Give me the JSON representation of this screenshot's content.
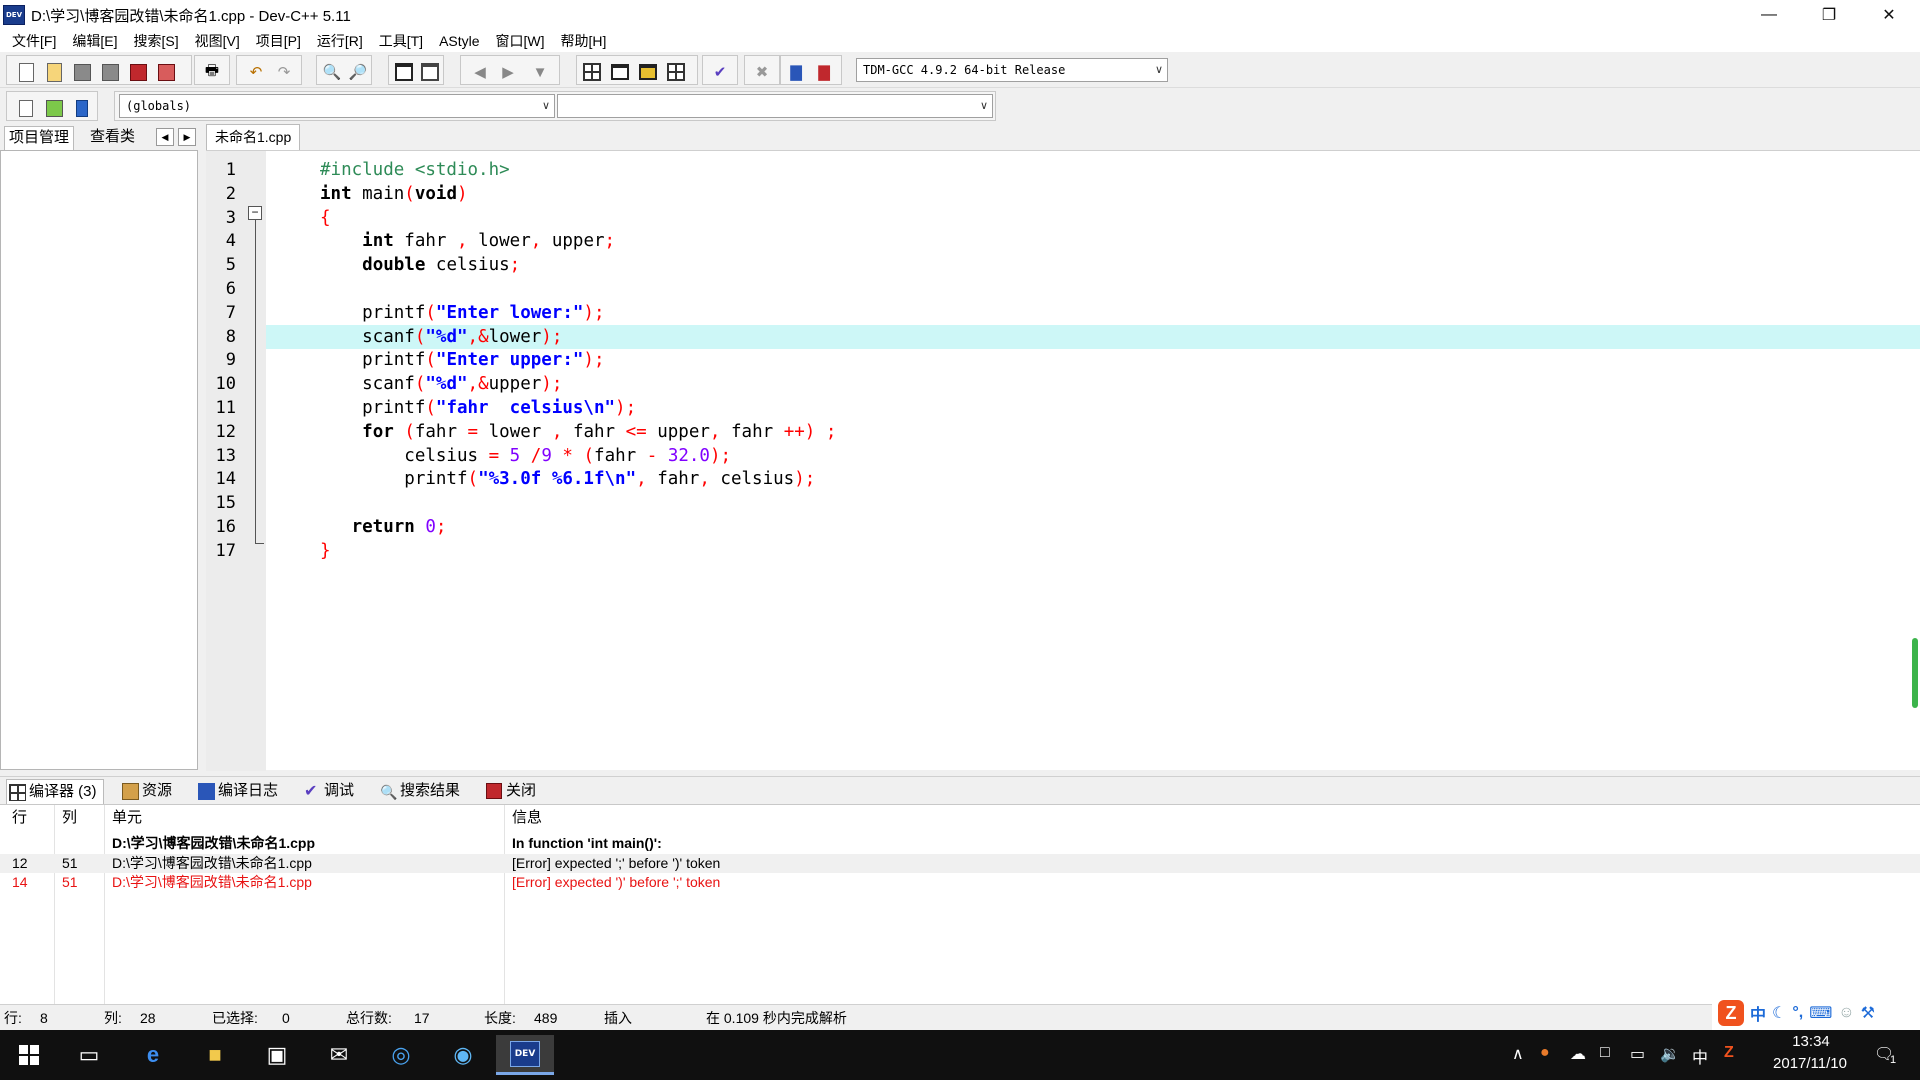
{
  "window": {
    "title": "D:\\学习\\博客园改错\\未命名1.cpp - Dev-C++ 5.11",
    "logo_text": "DEV"
  },
  "menu": [
    "文件[F]",
    "编辑[E]",
    "搜索[S]",
    "视图[V]",
    "项目[P]",
    "运行[R]",
    "工具[T]",
    "AStyle",
    "窗口[W]",
    "帮助[H]"
  ],
  "toolbar": {
    "compiler_select": "TDM-GCC 4.9.2 64-bit Release",
    "scope_select": "(globals)",
    "member_select": ""
  },
  "left_panel": {
    "tabs": [
      "项目管理",
      "查看类"
    ]
  },
  "editor": {
    "file_tab": "未命名1.cpp",
    "highlight_line": 8,
    "lines": [
      {
        "n": "1",
        "segs": [
          [
            "pp",
            "#include <stdio.h>"
          ]
        ]
      },
      {
        "n": "2",
        "segs": [
          [
            "kw",
            "int"
          ],
          [
            "",
            " main"
          ],
          [
            "sym",
            "("
          ],
          [
            "kw",
            "void"
          ],
          [
            "sym",
            ")"
          ]
        ]
      },
      {
        "n": "3",
        "segs": [
          [
            "sym",
            "{"
          ]
        ]
      },
      {
        "n": "4",
        "segs": [
          [
            "",
            "    "
          ],
          [
            "kw",
            "int"
          ],
          [
            "",
            " fahr "
          ],
          [
            "sym",
            ","
          ],
          [
            "",
            " lower"
          ],
          [
            "sym",
            ","
          ],
          [
            "",
            " upper"
          ],
          [
            "sym",
            ";"
          ]
        ]
      },
      {
        "n": "5",
        "segs": [
          [
            "",
            "    "
          ],
          [
            "kw",
            "double"
          ],
          [
            "",
            " celsius"
          ],
          [
            "sym",
            ";"
          ]
        ]
      },
      {
        "n": "6",
        "segs": []
      },
      {
        "n": "7",
        "segs": [
          [
            "",
            "    printf"
          ],
          [
            "sym",
            "("
          ],
          [
            "str",
            "\"Enter lower:\""
          ],
          [
            "sym",
            ");"
          ]
        ]
      },
      {
        "n": "8",
        "segs": [
          [
            "",
            "    scanf"
          ],
          [
            "sym",
            "("
          ],
          [
            "str",
            "\"%d\""
          ],
          [
            "sym",
            ",&"
          ],
          [
            "",
            "lower"
          ],
          [
            "sym",
            ");"
          ]
        ]
      },
      {
        "n": "9",
        "segs": [
          [
            "",
            "    printf"
          ],
          [
            "sym",
            "("
          ],
          [
            "str",
            "\"Enter upper:\""
          ],
          [
            "sym",
            ");"
          ]
        ]
      },
      {
        "n": "10",
        "segs": [
          [
            "",
            "    scanf"
          ],
          [
            "sym",
            "("
          ],
          [
            "str",
            "\"%d\""
          ],
          [
            "sym",
            ",&"
          ],
          [
            "",
            "upper"
          ],
          [
            "sym",
            ");"
          ]
        ]
      },
      {
        "n": "11",
        "segs": [
          [
            "",
            "    printf"
          ],
          [
            "sym",
            "("
          ],
          [
            "str",
            "\"fahr  celsius\\n\""
          ],
          [
            "sym",
            ");"
          ]
        ]
      },
      {
        "n": "12",
        "segs": [
          [
            "",
            "    "
          ],
          [
            "kw",
            "for"
          ],
          [
            "",
            " "
          ],
          [
            "sym",
            "("
          ],
          [
            "",
            "fahr "
          ],
          [
            "sym",
            "="
          ],
          [
            "",
            " lower "
          ],
          [
            "sym",
            ","
          ],
          [
            "",
            " fahr "
          ],
          [
            "sym",
            "<="
          ],
          [
            "",
            " upper"
          ],
          [
            "sym",
            ","
          ],
          [
            "",
            " fahr "
          ],
          [
            "sym",
            "++)"
          ],
          [
            "",
            " "
          ],
          [
            "sym",
            ";"
          ]
        ]
      },
      {
        "n": "13",
        "segs": [
          [
            "",
            "        celsius "
          ],
          [
            "sym",
            "="
          ],
          [
            "",
            " "
          ],
          [
            "num",
            "5"
          ],
          [
            "",
            " "
          ],
          [
            "sym",
            "/"
          ],
          [
            "num",
            "9"
          ],
          [
            "",
            " "
          ],
          [
            "sym",
            "*"
          ],
          [
            "",
            " "
          ],
          [
            "sym",
            "("
          ],
          [
            "",
            "fahr "
          ],
          [
            "sym",
            "-"
          ],
          [
            "",
            " "
          ],
          [
            "num",
            "32.0"
          ],
          [
            "sym",
            ");"
          ]
        ]
      },
      {
        "n": "14",
        "segs": [
          [
            "",
            "        printf"
          ],
          [
            "sym",
            "("
          ],
          [
            "str",
            "\"%3.0f %6.1f\\n\""
          ],
          [
            "sym",
            ","
          ],
          [
            "",
            " fahr"
          ],
          [
            "sym",
            ","
          ],
          [
            "",
            " celsius"
          ],
          [
            "sym",
            ");"
          ]
        ]
      },
      {
        "n": "15",
        "segs": []
      },
      {
        "n": "16",
        "segs": [
          [
            "",
            "   "
          ],
          [
            "kw",
            "return"
          ],
          [
            "",
            " "
          ],
          [
            "num",
            "0"
          ],
          [
            "sym",
            ";"
          ]
        ]
      },
      {
        "n": "17",
        "segs": [
          [
            "sym",
            "}"
          ]
        ]
      }
    ]
  },
  "bottom": {
    "tabs": [
      "编译器 (3)",
      "资源",
      "编译日志",
      "调试",
      "搜索结果",
      "关闭"
    ],
    "columns": [
      "行",
      "列",
      "单元",
      "信息"
    ],
    "rows": [
      {
        "line": "",
        "col": "",
        "unit": "D:\\学习\\博客园改错\\未命名1.cpp",
        "msg": "In function 'int main()':",
        "style": "bold"
      },
      {
        "line": "12",
        "col": "51",
        "unit": "D:\\学习\\博客园改错\\未命名1.cpp",
        "msg": "[Error] expected ';' before ')' token",
        "style": "alt"
      },
      {
        "line": "14",
        "col": "51",
        "unit": "D:\\学习\\博客园改错\\未命名1.cpp",
        "msg": "[Error] expected ')' before ';' token",
        "style": "err"
      }
    ]
  },
  "status": {
    "row_label": "行:",
    "row": "8",
    "col_label": "列:",
    "col": "28",
    "sel_label": "已选择:",
    "sel": "0",
    "total_label": "总行数:",
    "total": "17",
    "len_label": "长度:",
    "len": "489",
    "mode": "插入",
    "parse": "在 0.109 秒内完成解析"
  },
  "ime": {
    "logo": "Z",
    "lang": "中"
  },
  "taskbar": {
    "time": "13:34",
    "date": "2017/11/10",
    "tray_lang": "中",
    "notif_count": "1",
    "dev_label": "DEV"
  },
  "colors": {
    "keyword": "#000000",
    "string": "#0000ff",
    "symbol": "#ff0000",
    "number": "#8000ff",
    "preprocessor": "#2e8b57",
    "current_line": "#cdf7f7",
    "error_row": "#e81313"
  }
}
